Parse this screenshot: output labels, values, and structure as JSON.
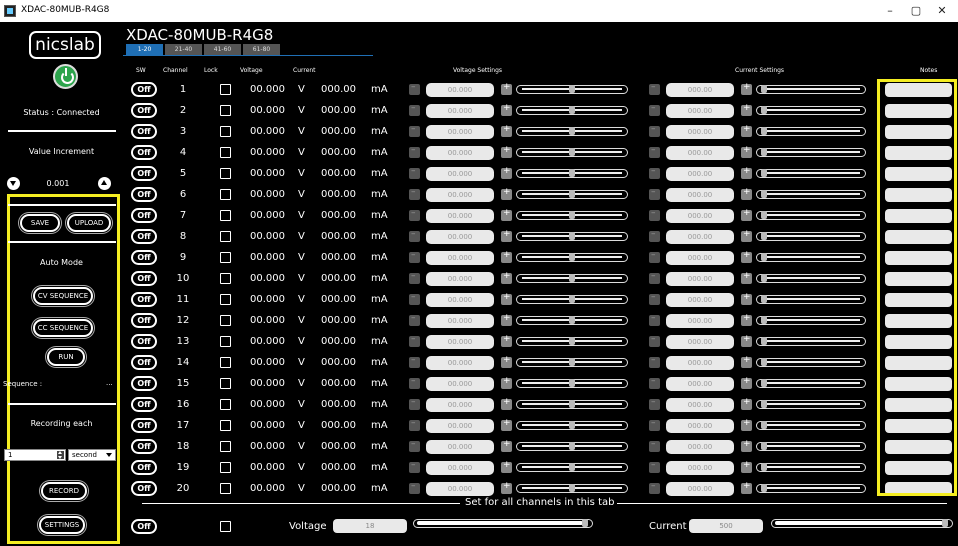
{
  "window": {
    "title": "XDAC-80MUB-R4G8",
    "minimize_label": "–",
    "maximize_label": "▢",
    "close_label": "✕"
  },
  "sidebar": {
    "logo_text": "nicslab",
    "status_text": "Status : Connected",
    "value_increment_label": "Value Increment",
    "increment_value": "0.001",
    "save_label": "SAVE",
    "upload_label": "UPLOAD",
    "auto_mode_label": "Auto Mode",
    "cv_sequence_label": "CV SEQUENCE",
    "cc_sequence_label": "CC SEQUENCE",
    "run_label": "RUN",
    "sequence_label": "Sequence :",
    "sequence_value": "...",
    "recording_label": "Recording each",
    "recording_value": "1",
    "recording_unit": "second",
    "record_label": "RECORD",
    "settings_label": "SETTINGS"
  },
  "main": {
    "device_title": "XDAC-80MUB-R4G8",
    "tabs": [
      {
        "label": "1-20",
        "active": true
      },
      {
        "label": "21-40",
        "active": false
      },
      {
        "label": "41-60",
        "active": false
      },
      {
        "label": "61-80",
        "active": false
      }
    ],
    "headers": {
      "sw": "SW",
      "channel": "Channel",
      "lock": "Lock",
      "voltage": "Voltage",
      "current": "Current",
      "voltage_settings": "Voltage Settings",
      "current_settings": "Current Settings",
      "notes": "Notes"
    },
    "channel_rows": [
      {
        "sw": "Off",
        "channel": "1",
        "voltage": "00.000",
        "voltage_unit": "V",
        "current": "000.00",
        "current_unit": "mA",
        "voltage_setting": "00.000",
        "current_setting": "000.00"
      },
      {
        "sw": "Off",
        "channel": "2",
        "voltage": "00.000",
        "voltage_unit": "V",
        "current": "000.00",
        "current_unit": "mA",
        "voltage_setting": "00.000",
        "current_setting": "000.00"
      },
      {
        "sw": "Off",
        "channel": "3",
        "voltage": "00.000",
        "voltage_unit": "V",
        "current": "000.00",
        "current_unit": "mA",
        "voltage_setting": "00.000",
        "current_setting": "000.00"
      },
      {
        "sw": "Off",
        "channel": "4",
        "voltage": "00.000",
        "voltage_unit": "V",
        "current": "000.00",
        "current_unit": "mA",
        "voltage_setting": "00.000",
        "current_setting": "000.00"
      },
      {
        "sw": "Off",
        "channel": "5",
        "voltage": "00.000",
        "voltage_unit": "V",
        "current": "000.00",
        "current_unit": "mA",
        "voltage_setting": "00.000",
        "current_setting": "000.00"
      },
      {
        "sw": "Off",
        "channel": "6",
        "voltage": "00.000",
        "voltage_unit": "V",
        "current": "000.00",
        "current_unit": "mA",
        "voltage_setting": "00.000",
        "current_setting": "000.00"
      },
      {
        "sw": "Off",
        "channel": "7",
        "voltage": "00.000",
        "voltage_unit": "V",
        "current": "000.00",
        "current_unit": "mA",
        "voltage_setting": "00.000",
        "current_setting": "000.00"
      },
      {
        "sw": "Off",
        "channel": "8",
        "voltage": "00.000",
        "voltage_unit": "V",
        "current": "000.00",
        "current_unit": "mA",
        "voltage_setting": "00.000",
        "current_setting": "000.00"
      },
      {
        "sw": "Off",
        "channel": "9",
        "voltage": "00.000",
        "voltage_unit": "V",
        "current": "000.00",
        "current_unit": "mA",
        "voltage_setting": "00.000",
        "current_setting": "000.00"
      },
      {
        "sw": "Off",
        "channel": "10",
        "voltage": "00.000",
        "voltage_unit": "V",
        "current": "000.00",
        "current_unit": "mA",
        "voltage_setting": "00.000",
        "current_setting": "000.00"
      },
      {
        "sw": "Off",
        "channel": "11",
        "voltage": "00.000",
        "voltage_unit": "V",
        "current": "000.00",
        "current_unit": "mA",
        "voltage_setting": "00.000",
        "current_setting": "000.00"
      },
      {
        "sw": "Off",
        "channel": "12",
        "voltage": "00.000",
        "voltage_unit": "V",
        "current": "000.00",
        "current_unit": "mA",
        "voltage_setting": "00.000",
        "current_setting": "000.00"
      },
      {
        "sw": "Off",
        "channel": "13",
        "voltage": "00.000",
        "voltage_unit": "V",
        "current": "000.00",
        "current_unit": "mA",
        "voltage_setting": "00.000",
        "current_setting": "000.00"
      },
      {
        "sw": "Off",
        "channel": "14",
        "voltage": "00.000",
        "voltage_unit": "V",
        "current": "000.00",
        "current_unit": "mA",
        "voltage_setting": "00.000",
        "current_setting": "000.00"
      },
      {
        "sw": "Off",
        "channel": "15",
        "voltage": "00.000",
        "voltage_unit": "V",
        "current": "000.00",
        "current_unit": "mA",
        "voltage_setting": "00.000",
        "current_setting": "000.00"
      },
      {
        "sw": "Off",
        "channel": "16",
        "voltage": "00.000",
        "voltage_unit": "V",
        "current": "000.00",
        "current_unit": "mA",
        "voltage_setting": "00.000",
        "current_setting": "000.00"
      },
      {
        "sw": "Off",
        "channel": "17",
        "voltage": "00.000",
        "voltage_unit": "V",
        "current": "000.00",
        "current_unit": "mA",
        "voltage_setting": "00.000",
        "current_setting": "000.00"
      },
      {
        "sw": "Off",
        "channel": "18",
        "voltage": "00.000",
        "voltage_unit": "V",
        "current": "000.00",
        "current_unit": "mA",
        "voltage_setting": "00.000",
        "current_setting": "000.00"
      },
      {
        "sw": "Off",
        "channel": "19",
        "voltage": "00.000",
        "voltage_unit": "V",
        "current": "000.00",
        "current_unit": "mA",
        "voltage_setting": "00.000",
        "current_setting": "000.00"
      },
      {
        "sw": "Off",
        "channel": "20",
        "voltage": "00.000",
        "voltage_unit": "V",
        "current": "000.00",
        "current_unit": "mA",
        "voltage_setting": "00.000",
        "current_setting": "000.00"
      }
    ],
    "set_all": {
      "title": "Set for all channels in this tab",
      "sw": "Off",
      "voltage_label": "Voltage",
      "voltage_value": "18",
      "current_label": "Current",
      "current_value": "500"
    }
  },
  "colors": {
    "highlight": "#f5ee22",
    "active_tab": "#1f6fb5",
    "power_on": "#2ca44c"
  },
  "icons": {
    "power": "power-icon",
    "increment_down": "triangle-down-icon",
    "increment_up": "triangle-up-icon"
  }
}
